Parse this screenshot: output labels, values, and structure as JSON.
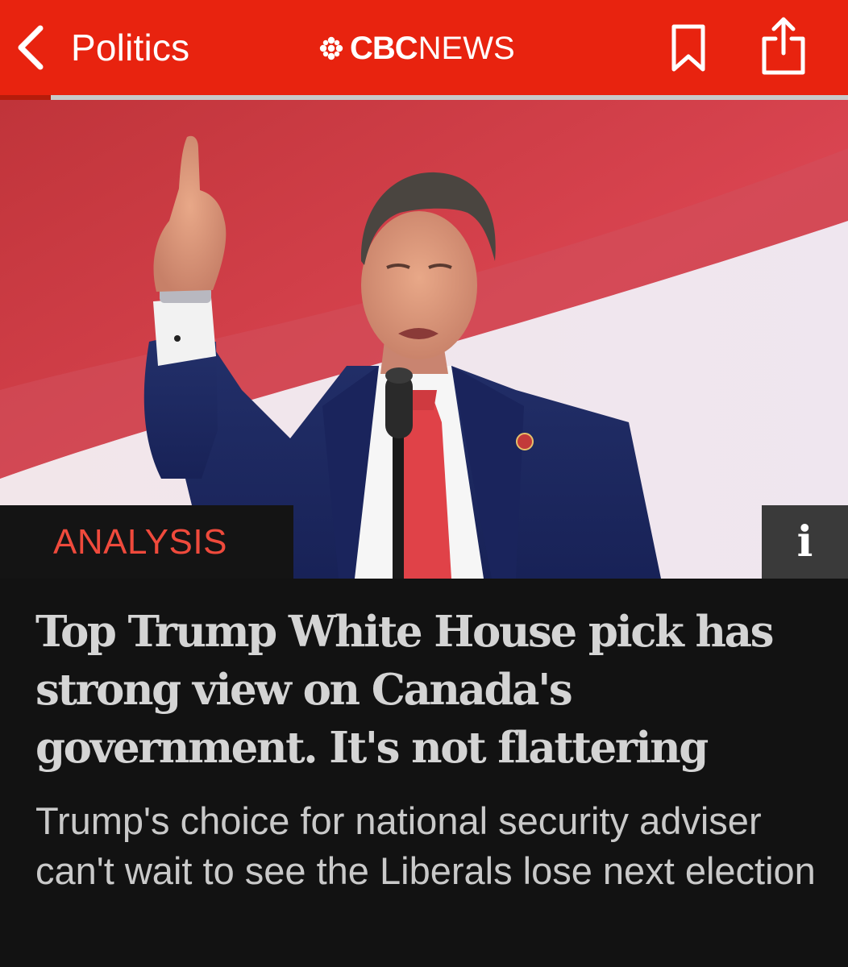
{
  "navbar": {
    "back_label": "Politics",
    "brand_bold": "CBC",
    "brand_light": "NEWS",
    "bookmark_icon": "bookmark-icon",
    "share_icon": "share-icon",
    "back_icon": "chevron-left-icon",
    "reading_progress": 0.06,
    "background_color": "#e8230f"
  },
  "hero": {
    "tag": "ANALYSIS",
    "tag_color": "#ef4a3c",
    "info_glyph": "i",
    "info_icon": "info-icon"
  },
  "article": {
    "headline": "Top Trump White House pick has strong view on Canada's government. It's not flattering",
    "dek": "Trump's choice for national security adviser can't wait to see the Liberals lose next election"
  }
}
